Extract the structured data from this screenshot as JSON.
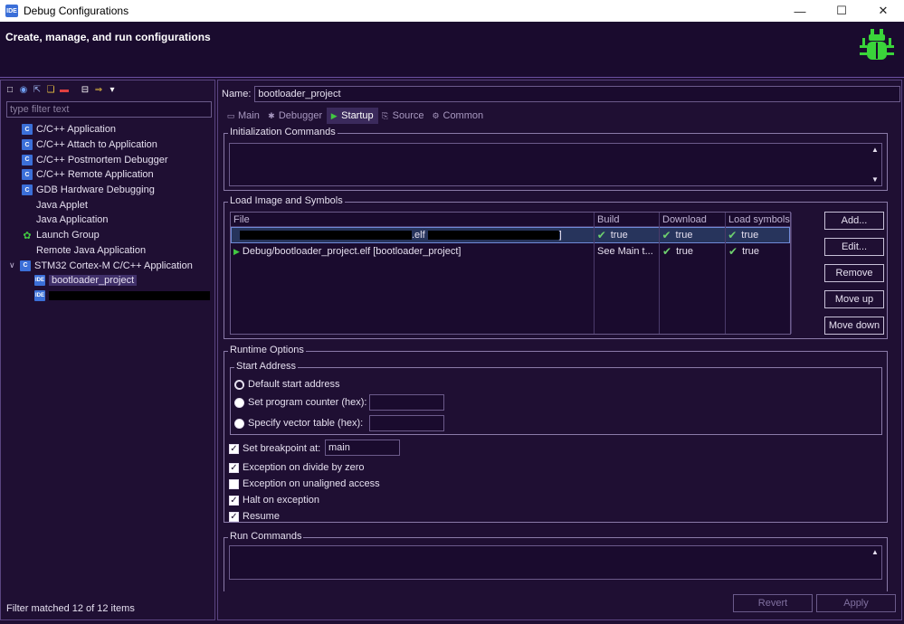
{
  "window": {
    "title": "Debug Configurations",
    "app_icon": "IDE"
  },
  "header": {
    "text": "Create, manage, and run configurations"
  },
  "left": {
    "filter_placeholder": "type filter text",
    "tree": [
      {
        "label": "C/C++ Application",
        "icon": "c"
      },
      {
        "label": "C/C++ Attach to Application",
        "icon": "c"
      },
      {
        "label": "C/C++ Postmortem Debugger",
        "icon": "c"
      },
      {
        "label": "C/C++ Remote Application",
        "icon": "c"
      },
      {
        "label": "GDB Hardware Debugging",
        "icon": "c"
      },
      {
        "label": "Java Applet",
        "icon": ""
      },
      {
        "label": "Java Application",
        "icon": ""
      },
      {
        "label": "Launch Group",
        "icon": "launch"
      },
      {
        "label": "Remote Java Application",
        "icon": ""
      },
      {
        "label": "STM32 Cortex-M C/C++ Application",
        "icon": "c"
      },
      {
        "label": "bootloader_project",
        "icon": "ide"
      }
    ],
    "status": "Filter matched 12 of 12 items"
  },
  "right": {
    "name_label": "Name:",
    "name_value": "bootloader_project",
    "tabs": [
      {
        "label": "Main",
        "icon": "main-icon",
        "glyph": "▭"
      },
      {
        "label": "Debugger",
        "icon": "debugger-icon",
        "glyph": "✱"
      },
      {
        "label": "Startup",
        "icon": "startup-icon",
        "glyph": "▶"
      },
      {
        "label": "Source",
        "icon": "source-icon",
        "glyph": "⎘"
      },
      {
        "label": "Common",
        "icon": "common-icon",
        "glyph": "⚙"
      }
    ],
    "init_commands_title": "Initialization Commands",
    "load_image_title": "Load Image and Symbols",
    "table": {
      "headers": [
        "File",
        "Build",
        "Download",
        "Load symbols"
      ],
      "rows": [
        {
          "file_visible": ".elf",
          "file_end": "]",
          "build": "true",
          "download": "true",
          "load_symbols": "true"
        },
        {
          "file": "Debug/bootloader_project.elf [bootloader_project]",
          "build": "See Main t...",
          "download": "true",
          "load_symbols": "true"
        }
      ]
    },
    "buttons": {
      "add": "Add...",
      "edit": "Edit...",
      "remove": "Remove",
      "move_up": "Move up",
      "move_down": "Move down"
    },
    "runtime_title": "Runtime Options",
    "start_address_title": "Start Address",
    "radios": [
      {
        "label": "Default start address",
        "selected": true
      },
      {
        "label": "Set program counter (hex):",
        "selected": false
      },
      {
        "label": "Specify vector table (hex):",
        "selected": false
      }
    ],
    "checks": [
      {
        "label": "Set breakpoint at:",
        "checked": true
      },
      {
        "label": "Exception on divide by zero",
        "checked": true
      },
      {
        "label": "Exception on unaligned access",
        "checked": false
      },
      {
        "label": "Halt on exception",
        "checked": true
      },
      {
        "label": "Resume",
        "checked": true
      }
    ],
    "breakpoint_value": "main",
    "run_commands_title": "Run Commands",
    "revert": "Revert",
    "apply": "Apply"
  },
  "colors": {
    "background": "#1f0f33",
    "accent_green": "#42c842",
    "selection": "#40306a"
  }
}
